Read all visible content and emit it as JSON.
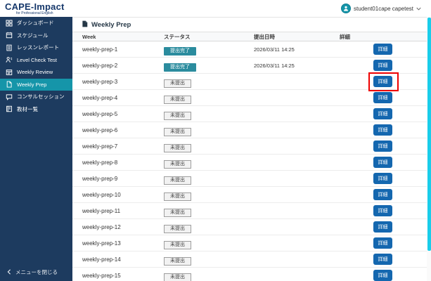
{
  "colors": {
    "sidebar_navy": "#1d3b5f",
    "active_teal": "#1595a9",
    "badge_done_teal": "#2b8c9e",
    "detail_button_blue": "#1467af",
    "scrollbar_cyan": "#19cdea",
    "highlight_red": "#ee0000",
    "logo_navy": "#16386b"
  },
  "topbar": {
    "logo_title": "CAPE-Impact",
    "logo_tagline": "for Professional English",
    "user_name": "student01cape capetest",
    "user_avatar_icon": "person-icon",
    "user_chevron_icon": "chevron-down-icon"
  },
  "sidebar": {
    "items": [
      {
        "id": "dashboard",
        "label": "ダッシュボード",
        "icon": "dashboard-icon",
        "active": false
      },
      {
        "id": "schedule",
        "label": "スケジュール",
        "icon": "schedule-icon",
        "active": false
      },
      {
        "id": "lesson-report",
        "label": "レッスンレポート",
        "icon": "lesson-report-icon",
        "active": false
      },
      {
        "id": "level-check-test",
        "label": "Level Check Test",
        "icon": "level-check-icon",
        "active": false
      },
      {
        "id": "weekly-review",
        "label": "Weekly Review",
        "icon": "weekly-review-icon",
        "active": false
      },
      {
        "id": "weekly-prep",
        "label": "Weekly Prep",
        "icon": "weekly-prep-icon",
        "active": true
      },
      {
        "id": "consult-session",
        "label": "コンサルセッション",
        "icon": "consult-session-icon",
        "active": false
      },
      {
        "id": "materials",
        "label": "教材一覧",
        "icon": "materials-icon",
        "active": false
      }
    ],
    "collapse_label": "メニューを閉じる",
    "collapse_icon": "chevron-left-icon"
  },
  "main": {
    "panel_title": "Weekly Prep",
    "panel_title_icon": "document-icon",
    "table": {
      "headers": [
        "Week",
        "ステータス",
        "提出日時",
        "詳細"
      ],
      "detail_button_label": "詳細",
      "rows": [
        {
          "week": "weekly-prep-1",
          "status": "提出完了",
          "submitted": true,
          "datetime": "2026/03/11 14:25",
          "highlight": false
        },
        {
          "week": "weekly-prep-2",
          "status": "提出完了",
          "submitted": true,
          "datetime": "2026/03/11 14:25",
          "highlight": false
        },
        {
          "week": "weekly-prep-3",
          "status": "未提出",
          "submitted": false,
          "datetime": "",
          "highlight": true
        },
        {
          "week": "weekly-prep-4",
          "status": "未提出",
          "submitted": false,
          "datetime": "",
          "highlight": false
        },
        {
          "week": "weekly-prep-5",
          "status": "未提出",
          "submitted": false,
          "datetime": "",
          "highlight": false
        },
        {
          "week": "weekly-prep-6",
          "status": "未提出",
          "submitted": false,
          "datetime": "",
          "highlight": false
        },
        {
          "week": "weekly-prep-7",
          "status": "未提出",
          "submitted": false,
          "datetime": "",
          "highlight": false
        },
        {
          "week": "weekly-prep-8",
          "status": "未提出",
          "submitted": false,
          "datetime": "",
          "highlight": false
        },
        {
          "week": "weekly-prep-9",
          "status": "未提出",
          "submitted": false,
          "datetime": "",
          "highlight": false
        },
        {
          "week": "weekly-prep-10",
          "status": "未提出",
          "submitted": false,
          "datetime": "",
          "highlight": false
        },
        {
          "week": "weekly-prep-11",
          "status": "未提出",
          "submitted": false,
          "datetime": "",
          "highlight": false
        },
        {
          "week": "weekly-prep-12",
          "status": "未提出",
          "submitted": false,
          "datetime": "",
          "highlight": false
        },
        {
          "week": "weekly-prep-13",
          "status": "未提出",
          "submitted": false,
          "datetime": "",
          "highlight": false
        },
        {
          "week": "weekly-prep-14",
          "status": "未提出",
          "submitted": false,
          "datetime": "",
          "highlight": false
        },
        {
          "week": "weekly-prep-15",
          "status": "未提出",
          "submitted": false,
          "datetime": "",
          "highlight": false
        }
      ]
    }
  }
}
